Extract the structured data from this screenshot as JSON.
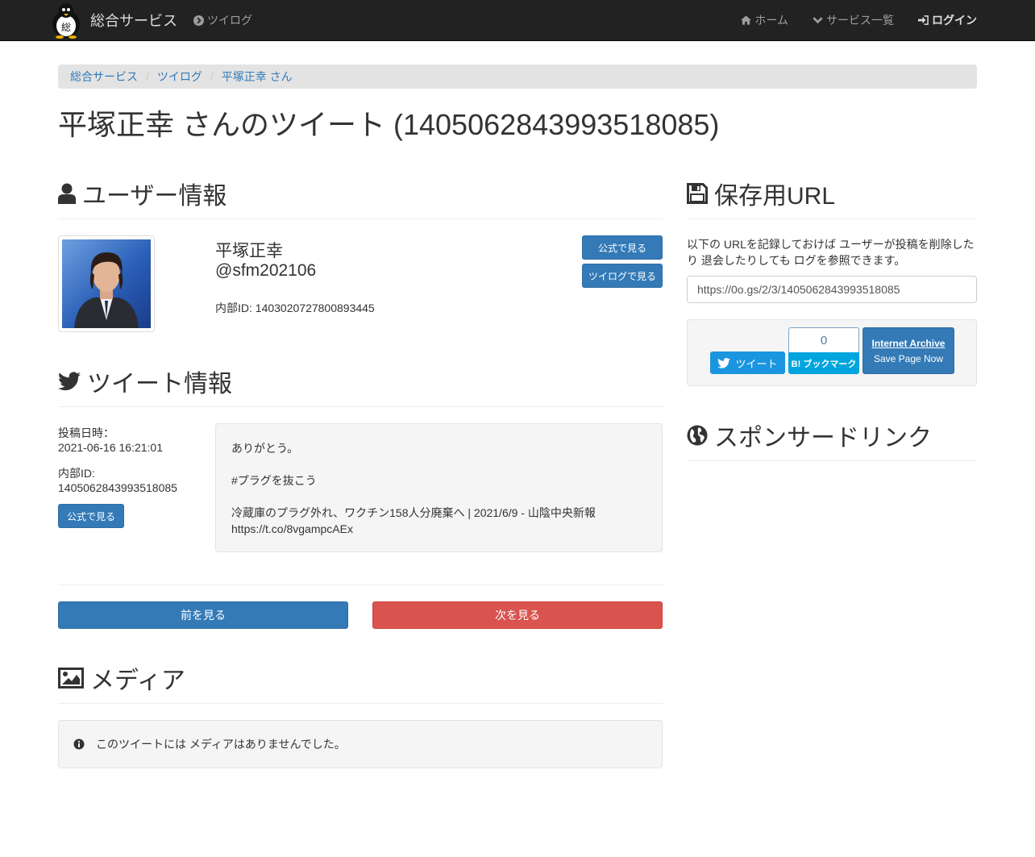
{
  "navbar": {
    "brand": "総合サービス",
    "left_link": "ツイログ",
    "right_links": [
      "ホーム",
      "サービス一覧",
      "ログイン"
    ]
  },
  "breadcrumb": [
    "総合サービス",
    "ツイログ",
    "平塚正幸 さん"
  ],
  "page_title": "平塚正幸 さんのツイート (1405062843993518085)",
  "user_section": {
    "heading": "ユーザー情報",
    "name": "平塚正幸",
    "handle": "@sfm202106",
    "internal_id": "内部ID: 1403020727800893445",
    "buttons": [
      "公式で見る",
      "ツイログで見る"
    ]
  },
  "tweet_section": {
    "heading": "ツイート情報",
    "posted_label": "投稿日時：",
    "posted_value": "2021-06-16 16:21:01",
    "id_label": "内部ID:",
    "id_value": "1405062843993518085",
    "official_button": "公式で見る",
    "body": {
      "line1": "ありがとう。",
      "line2": "#プラグを抜こう",
      "line3": "冷蔵庫のプラグ外れ、ワクチン158人分廃棄へ | 2021/6/9 - 山陰中央新報",
      "line4": "https://t.co/8vgampcAEx"
    }
  },
  "pager": {
    "prev": "前を見る",
    "next": "次を見る"
  },
  "media_section": {
    "heading": "メディア",
    "empty_message": "このツイートには メディアはありませんでした。"
  },
  "save_section": {
    "heading": "保存用URL",
    "description": "以下の URLを記録しておけば ユーザーが投稿を削除したり 退会したりしても ログを参照できます。",
    "url": "https://0o.gs/2/3/1405062843993518085",
    "tweet_button": "ツイート",
    "hatena_count": "0",
    "hatena_button": "B! ブックマーク",
    "ia_title": "Internet Archive",
    "ia_sub": "Save Page Now"
  },
  "sponsor_section": {
    "heading": "スポンサードリンク"
  }
}
